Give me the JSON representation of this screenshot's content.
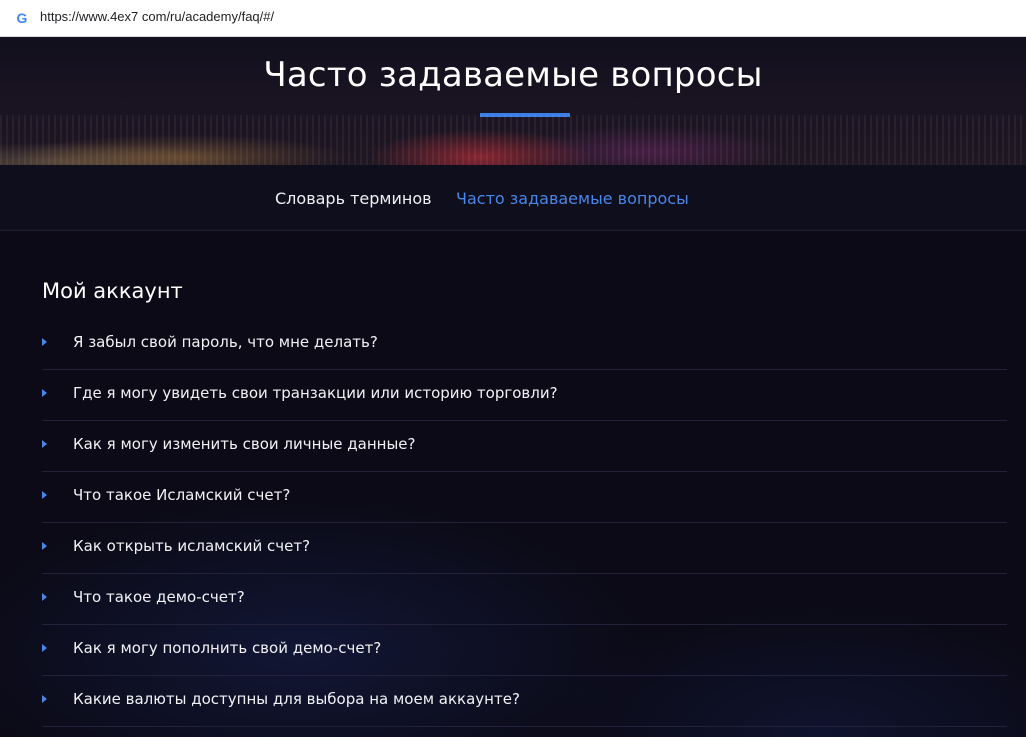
{
  "browser": {
    "url": "https://www.4ex7 com/ru/academy/faq/#/",
    "favicon": "G"
  },
  "hero": {
    "title": "Часто задаваемые вопросы"
  },
  "nav": {
    "items": [
      {
        "label": "Словарь терминов",
        "active": false
      },
      {
        "label": "Часто задаваемые вопросы",
        "active": true
      }
    ]
  },
  "section": {
    "title": "Мой аккаунт",
    "questions": [
      "Я забыл свой пароль, что мне делать?",
      "Где я могу увидеть свои транзакции или историю торговли?",
      "Как я могу изменить свои личные данные?",
      "Что такое Исламский счет?",
      "Как открыть исламский счет?",
      "Что такое демо-счет?",
      "Как я могу пополнить свой демо-счет?",
      "Какие валюты доступны для выбора на моем аккаунте?"
    ]
  },
  "colors": {
    "accent": "#4a86e8",
    "background": "#0b0a16",
    "text": "#f2f2f6"
  }
}
